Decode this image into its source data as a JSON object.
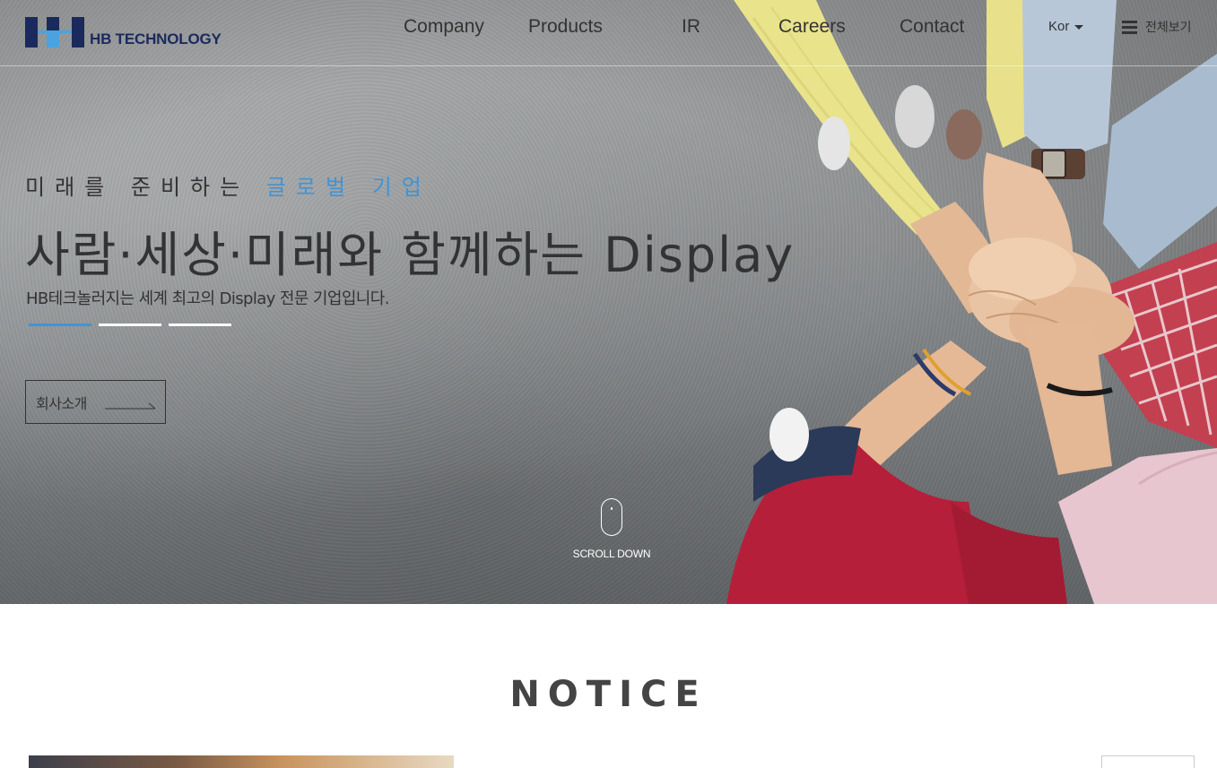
{
  "header": {
    "logo_text": "HB TECHNOLOGY",
    "nav": [
      {
        "label": "Company"
      },
      {
        "label": "Products"
      },
      {
        "label": "IR"
      },
      {
        "label": "Careers"
      },
      {
        "label": "Contact"
      }
    ],
    "language": "Kor",
    "all_menu_label": "전체보기"
  },
  "hero": {
    "eyebrow_prefix": "미래를 준비하는",
    "eyebrow_accent": "글로벌 기업",
    "headline": "사람·세상·미래와 함께하는 Display",
    "subline": "HB테크놀러지는 세계 최고의 Display 전문 기업입니다.",
    "slides": 3,
    "active_slide": 1,
    "cta_label": "회사소개",
    "scroll_label": "SCROLL DOWN"
  },
  "notice": {
    "title": "NOTICE"
  },
  "colors": {
    "accent": "#3f94d6",
    "brand_navy": "#1b2a5c",
    "text": "#333333"
  }
}
